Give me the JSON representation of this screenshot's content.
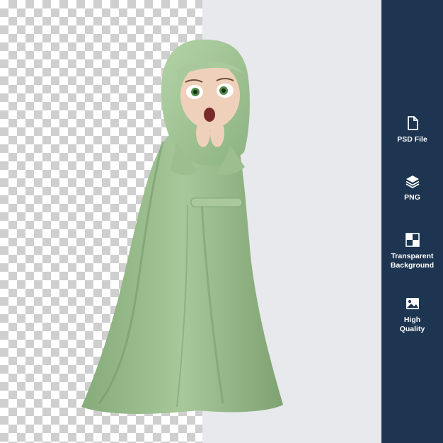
{
  "features": [
    {
      "icon": "file-icon",
      "label": "PSD File"
    },
    {
      "icon": "layers-icon",
      "label": "PNG"
    },
    {
      "icon": "transparency-icon",
      "label": "Transparent\nBackground"
    },
    {
      "icon": "image-icon",
      "label": "High\nQuality"
    }
  ],
  "colors": {
    "sidebar": "#1d3550",
    "panel": "#e8e9ec",
    "garment": "#9bbf8f"
  }
}
